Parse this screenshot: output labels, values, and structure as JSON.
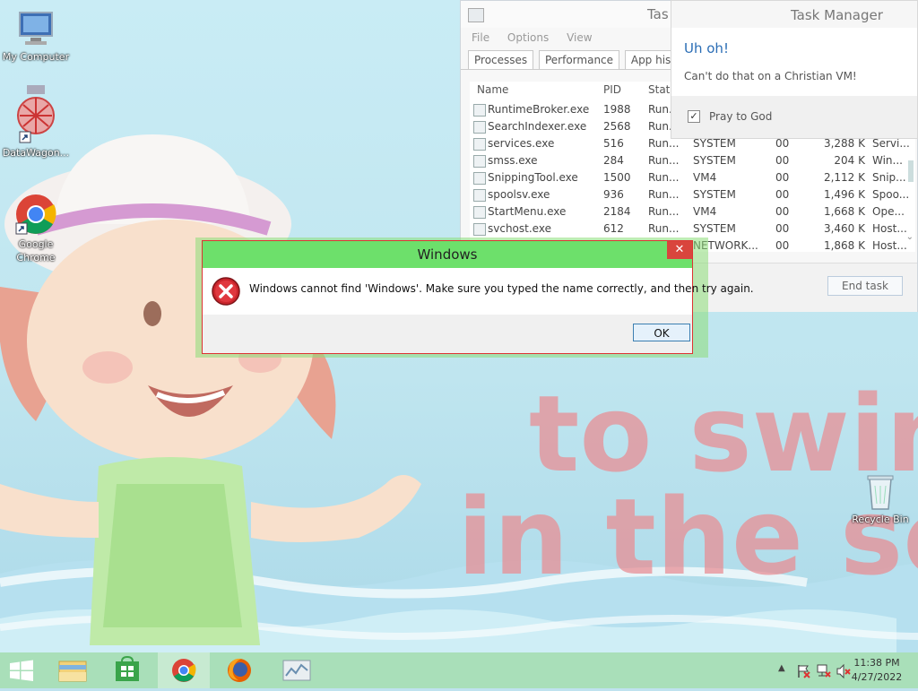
{
  "desktop": {
    "icons": [
      {
        "label": "My Computer"
      },
      {
        "label": "DataWagon..."
      },
      {
        "label": "Google Chrome"
      },
      {
        "label": "Recycle Bin"
      }
    ]
  },
  "wallpaper_text": "to swim in the se",
  "task_manager": {
    "title": "Task Manager",
    "title_partial": "Tas",
    "menu": [
      "File",
      "Options",
      "View"
    ],
    "tabs": [
      "Processes",
      "Performance",
      "App history"
    ],
    "columns": [
      "Name",
      "PID",
      "Statu"
    ],
    "rows": [
      {
        "name": "RuntimeBroker.exe",
        "pid": "1988",
        "status": "Run...",
        "user": "",
        "cpu": "",
        "mem": "",
        "desc": ""
      },
      {
        "name": "SearchIndexer.exe",
        "pid": "2568",
        "status": "Run...",
        "user": "",
        "cpu": "",
        "mem": "",
        "desc": ""
      },
      {
        "name": "services.exe",
        "pid": "516",
        "status": "Run...",
        "user": "SYSTEM",
        "cpu": "00",
        "mem": "3,288 K",
        "desc": "Servi..."
      },
      {
        "name": "smss.exe",
        "pid": "284",
        "status": "Run...",
        "user": "SYSTEM",
        "cpu": "00",
        "mem": "204 K",
        "desc": "Win..."
      },
      {
        "name": "SnippingTool.exe",
        "pid": "1500",
        "status": "Run...",
        "user": "VM4",
        "cpu": "00",
        "mem": "2,112 K",
        "desc": "Snip..."
      },
      {
        "name": "spoolsv.exe",
        "pid": "936",
        "status": "Run...",
        "user": "SYSTEM",
        "cpu": "00",
        "mem": "1,496 K",
        "desc": "Spoo..."
      },
      {
        "name": "StartMenu.exe",
        "pid": "2184",
        "status": "Run...",
        "user": "VM4",
        "cpu": "00",
        "mem": "1,668 K",
        "desc": "Ope..."
      },
      {
        "name": "svchost.exe",
        "pid": "612",
        "status": "Run...",
        "user": "SYSTEM",
        "cpu": "00",
        "mem": "3,460 K",
        "desc": "Host..."
      },
      {
        "name": "",
        "pid": "",
        "status": "",
        "user": "NETWORK...",
        "cpu": "00",
        "mem": "1,868 K",
        "desc": "Host..."
      }
    ],
    "end_task_label": "End task"
  },
  "uh_oh": {
    "heading": "Uh oh!",
    "message": "Can't do that on a Christian VM!",
    "checkbox_label": "Pray to God",
    "checked": true
  },
  "error_dialog": {
    "title": "Windows",
    "message": "Windows cannot find 'Windows'. Make sure you typed the name correctly, and then try again.",
    "ok_label": "OK"
  },
  "taskbar": {
    "items": [
      "start-icon",
      "file-explorer-icon",
      "store-icon",
      "chrome-icon",
      "firefox-icon",
      "task-manager-icon"
    ],
    "time": "11:38 PM",
    "date": "4/27/2022"
  }
}
